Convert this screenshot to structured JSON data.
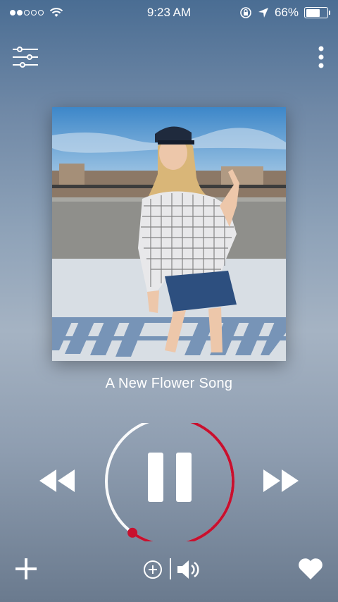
{
  "status_bar": {
    "time": "9:23 AM",
    "battery": "66%",
    "battery_level": 0.66,
    "signal_filled": 2,
    "signal_total": 5,
    "icons": [
      "wifi-icon",
      "rotation-lock-icon",
      "location-arrow-icon",
      "battery-icon"
    ]
  },
  "header": {
    "left_icon": "equalizer-sliders-icon",
    "right_icon": "more-vertical-icon"
  },
  "album": {
    "art": "photo of a blonde woman in a black cap, checkered shirt and denim skirt on a rooftop"
  },
  "track": {
    "title": "A New Flower Song",
    "progress": 0.6
  },
  "controls": {
    "previous_icon": "rewind-icon",
    "play_state_icon": "pause-icon",
    "next_icon": "fast-forward-icon"
  },
  "bottom": {
    "add_icon": "plus-icon",
    "queue_icon": "add-circle-icon",
    "volume_icon": "volume-icon",
    "favorite_icon": "heart-icon"
  },
  "colors": {
    "accent": "#c8102e",
    "track": "#ffffff"
  }
}
